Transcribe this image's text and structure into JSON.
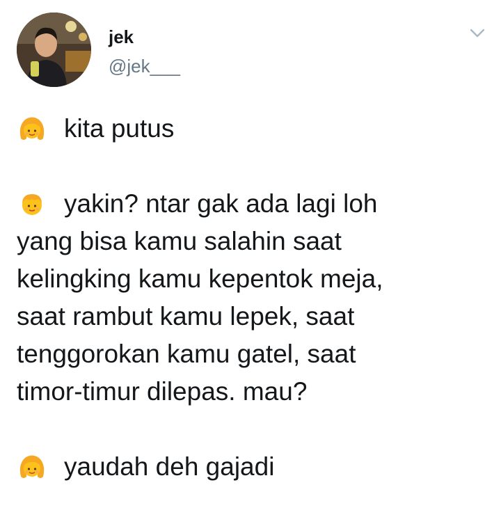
{
  "user": {
    "display_name": "jek",
    "handle": "@jek___"
  },
  "header": {
    "menu_icon": "chevron-down-icon",
    "accent_gray": "#657786",
    "text_color": "#14171a"
  },
  "tweet": {
    "lines": [
      "kita putus",
      "",
      "yakin? ntar gak ada lagi loh",
      "yang bisa kamu salahin saat",
      "kelingking kamu kepentok meja,",
      "saat rambut kamu lepek, saat",
      "tenggorokan kamu gatel, saat",
      "timor-timur dilepas. mau?",
      "",
      "yaudah deh gajadi"
    ],
    "emojis": {
      "girl": "girl-emoji",
      "boy": "boy-emoji"
    }
  }
}
